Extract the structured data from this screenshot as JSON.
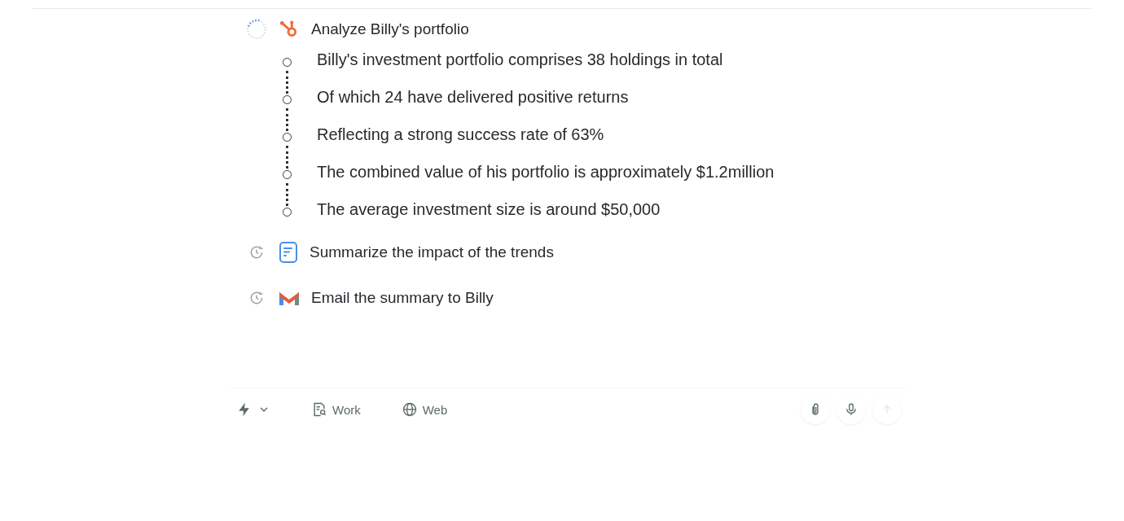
{
  "tasks": [
    {
      "status": {
        "kind": "running"
      },
      "icon": {
        "kind": "hubspot"
      },
      "label": "Analyze Billy's portfolio",
      "steps": [
        "Billy's investment portfolio comprises 38 holdings in total",
        "Of which 24 have delivered positive returns",
        "Reflecting a strong success rate of 63%",
        "The combined value of his portfolio is approximately $1.2million",
        "The average investment size is around $50,000"
      ]
    },
    {
      "status": {
        "kind": "pending"
      },
      "icon": {
        "kind": "document"
      },
      "label": "Summarize the impact of the trends"
    },
    {
      "status": {
        "kind": "pending"
      },
      "icon": {
        "kind": "gmail"
      },
      "label": "Email the summary to Billy"
    }
  ],
  "toolbar": {
    "modes": [
      {
        "kind": "work",
        "label": "Work"
      },
      {
        "kind": "web",
        "label": "Web"
      }
    ]
  }
}
